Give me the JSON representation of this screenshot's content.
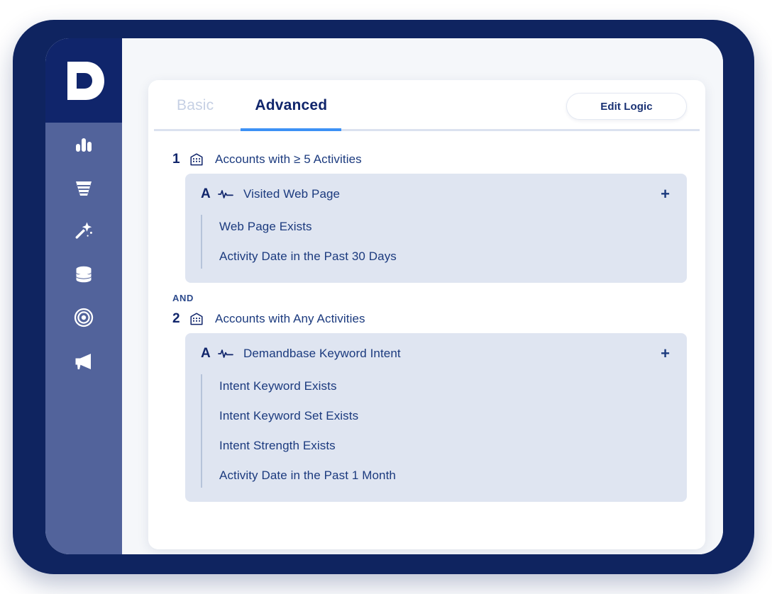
{
  "app": {
    "logo_icon": "demandbase-d-logo"
  },
  "sidebar": {
    "items": [
      {
        "icon": "bar-chart-icon",
        "name": "analytics"
      },
      {
        "icon": "funnel-icon",
        "name": "funnel"
      },
      {
        "icon": "magic-wand-icon",
        "name": "intelligence"
      },
      {
        "icon": "database-icon",
        "name": "data"
      },
      {
        "icon": "target-icon",
        "name": "audiences"
      },
      {
        "icon": "megaphone-icon",
        "name": "campaigns"
      }
    ]
  },
  "tabs": [
    {
      "label": "Basic",
      "active": false
    },
    {
      "label": "Advanced",
      "active": true
    }
  ],
  "toolbar": {
    "edit_logic_label": "Edit Logic"
  },
  "operators": {
    "and": "AND"
  },
  "controls": {
    "add_label": "+"
  },
  "groups": [
    {
      "index": "1",
      "icon": "building-icon",
      "title": "Accounts with  ≥  5 Activities",
      "blocks": [
        {
          "letter": "A",
          "icon": "activity-pulse-icon",
          "title": "Visited Web Page",
          "conditions": [
            "Web Page Exists",
            "Activity Date in the Past 30 Days"
          ]
        }
      ]
    },
    {
      "index": "2",
      "icon": "building-icon",
      "title": "Accounts with Any Activities",
      "blocks": [
        {
          "letter": "A",
          "icon": "activity-pulse-icon",
          "title": "Demandbase Keyword Intent",
          "conditions": [
            "Intent Keyword Exists",
            "Intent Keyword Set Exists",
            "Intent Strength Exists",
            "Activity Date in the Past 1 Month"
          ]
        }
      ]
    }
  ],
  "colors": {
    "frame_navy": "#0f2460",
    "sidebar_header": "#10256b",
    "sidebar_body": "#52639b",
    "page_bg": "#f5f7fa",
    "card_bg": "#ffffff",
    "block_bg": "#dfe5f1",
    "accent_blue": "#3d91f5",
    "text_navy": "#1b3a7e",
    "tab_inactive": "#c6d0e4"
  }
}
